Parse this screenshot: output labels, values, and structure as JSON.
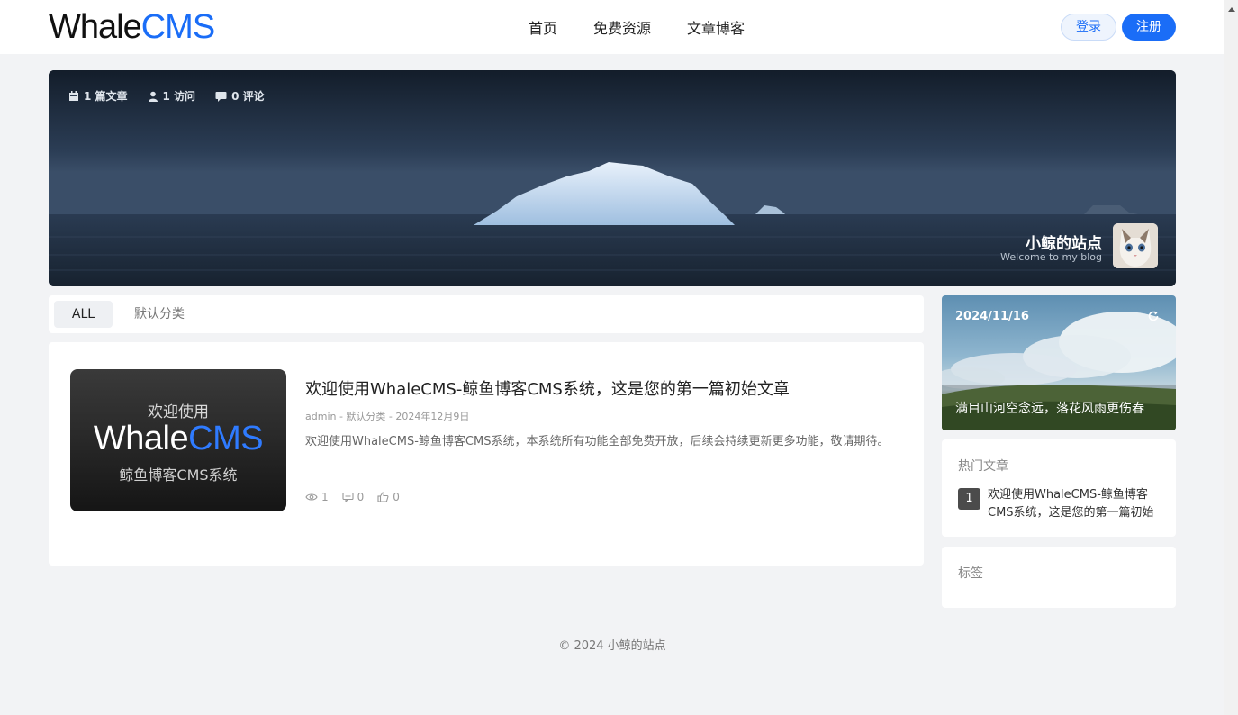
{
  "header": {
    "logo_part1": "Whale",
    "logo_part2": "CMS",
    "nav": [
      "首页",
      "免费资源",
      "文章博客"
    ],
    "login": "登录",
    "register": "注册"
  },
  "banner": {
    "stats": [
      {
        "icon": "calendar-icon",
        "text": "1 篇文章"
      },
      {
        "icon": "user-icon",
        "text": "1 访问"
      },
      {
        "icon": "comment-icon",
        "text": "0 评论"
      }
    ],
    "site_name": "小鲸的站点",
    "site_sub": "Welcome to my blog"
  },
  "categories": {
    "all": "ALL",
    "default": "默认分类"
  },
  "article": {
    "thumb_line1": "欢迎使用",
    "thumb_logo1": "Whale",
    "thumb_logo2": "CMS",
    "thumb_line3": "鲸鱼博客CMS系统",
    "title": "欢迎使用WhaleCMS-鲸鱼博客CMS系统，这是您的第一篇初始文章",
    "meta": "admin - 默认分类 - 2024年12月9日",
    "excerpt": "欢迎使用WhaleCMS-鲸鱼博客CMS系统，本系统所有功能全部免费开放，后续会持续更新更多功能，敬请期待。",
    "views": "1",
    "comments": "0",
    "likes": "0"
  },
  "sidebar": {
    "date": "2024/11/16",
    "quote": "满目山河空念远，落花风雨更伤春",
    "hot_title": "热门文章",
    "hot_items": [
      {
        "rank": "1",
        "title": "欢迎使用WhaleCMS-鲸鱼博客CMS系统，这是您的第一篇初始文章"
      }
    ],
    "tags_title": "标签"
  },
  "footer": {
    "copyright": "© 2024 小鲸的站点"
  },
  "colors": {
    "accent": "#1a6df7",
    "background": "#f2f3f5"
  }
}
